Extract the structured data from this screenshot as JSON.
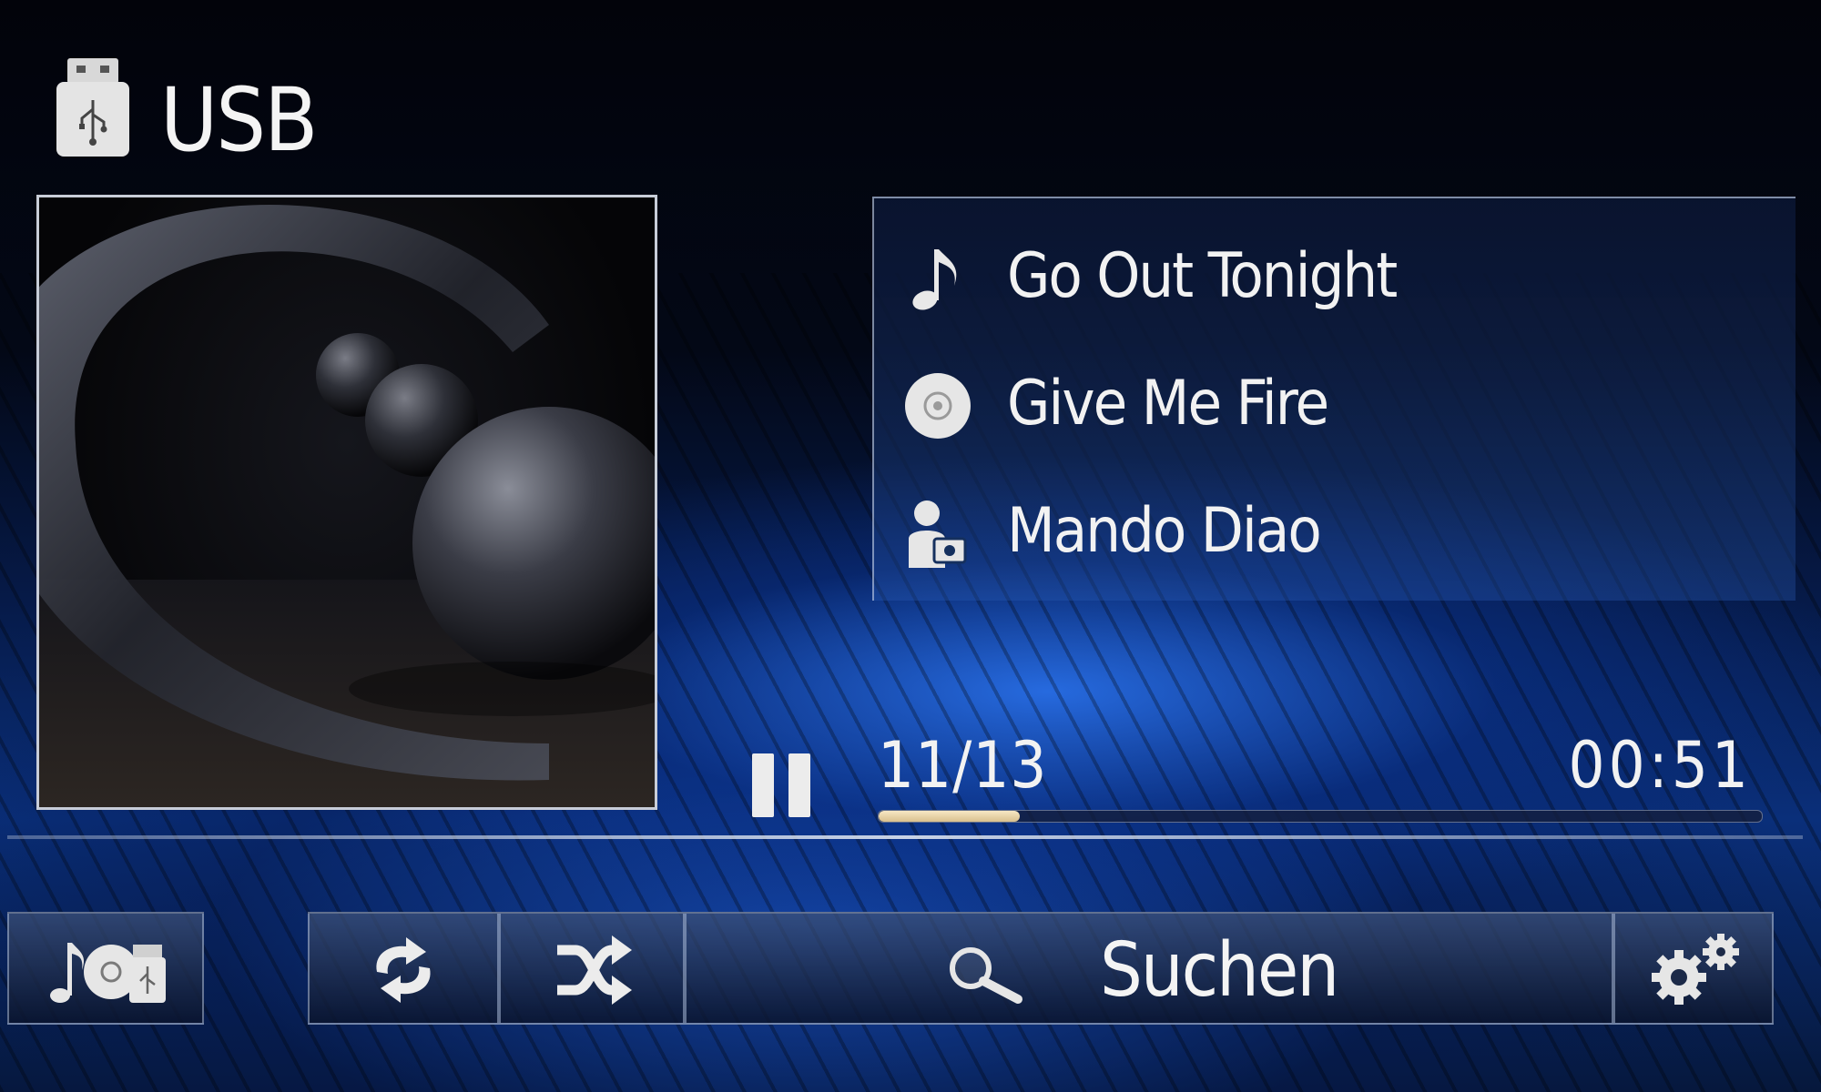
{
  "header": {
    "source_title": "USB",
    "source_icon": "usb-drive-icon"
  },
  "album_art": {
    "icon": "album-cover-image"
  },
  "track_info": {
    "title": "Go Out Tonight",
    "title_icon": "music-note-icon",
    "album": "Give Me Fire",
    "album_icon": "disc-icon",
    "artist": "Mando Diao",
    "artist_icon": "artist-icon"
  },
  "playback": {
    "state_icon": "pause-icon",
    "track_counter": "11/13",
    "elapsed_time": "00:51",
    "progress_fraction": 0.16
  },
  "bottom_bar": {
    "source_icon": "media-source-icon",
    "repeat_icon": "repeat-icon",
    "shuffle_icon": "shuffle-icon",
    "search_label": "Suchen",
    "search_icon": "magnifier-icon",
    "settings_icon": "settings-gears-icon"
  },
  "colors": {
    "accent_blue": "#2a6fe0",
    "progress_fill": "#efdcae",
    "text": "#f2f2f2"
  }
}
